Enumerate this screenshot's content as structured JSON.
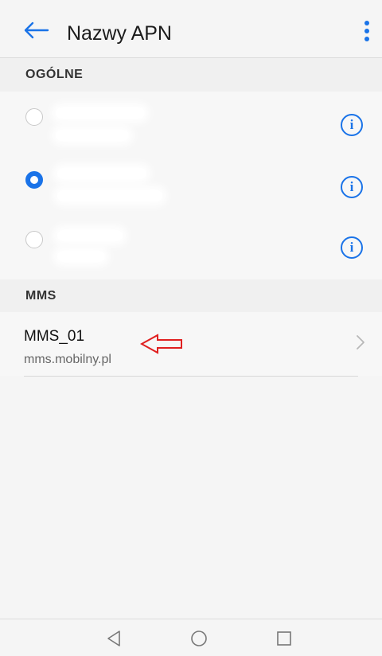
{
  "header": {
    "title": "Nazwy APN",
    "back_icon": "arrow-left-icon",
    "menu_icon": "more-vert-icon"
  },
  "sections": {
    "general": {
      "label": "OGÓLNE"
    },
    "mms": {
      "label": "MMS"
    }
  },
  "apn_list": [
    {
      "selected": false,
      "info_icon": "info-icon"
    },
    {
      "selected": true,
      "info_icon": "info-icon"
    },
    {
      "selected": false,
      "info_icon": "info-icon"
    }
  ],
  "mms_list": [
    {
      "name": "MMS_01",
      "apn": "mms.mobilny.pl",
      "chevron_icon": "chevron-right-icon"
    }
  ],
  "annotation": {
    "icon": "red-arrow-left-icon",
    "color": "#e02020"
  },
  "navbar": {
    "back_icon": "nav-back-icon",
    "home_icon": "nav-home-icon",
    "recents_icon": "nav-recents-icon"
  },
  "colors": {
    "accent": "#1a73e8",
    "annotation": "#e02020"
  }
}
